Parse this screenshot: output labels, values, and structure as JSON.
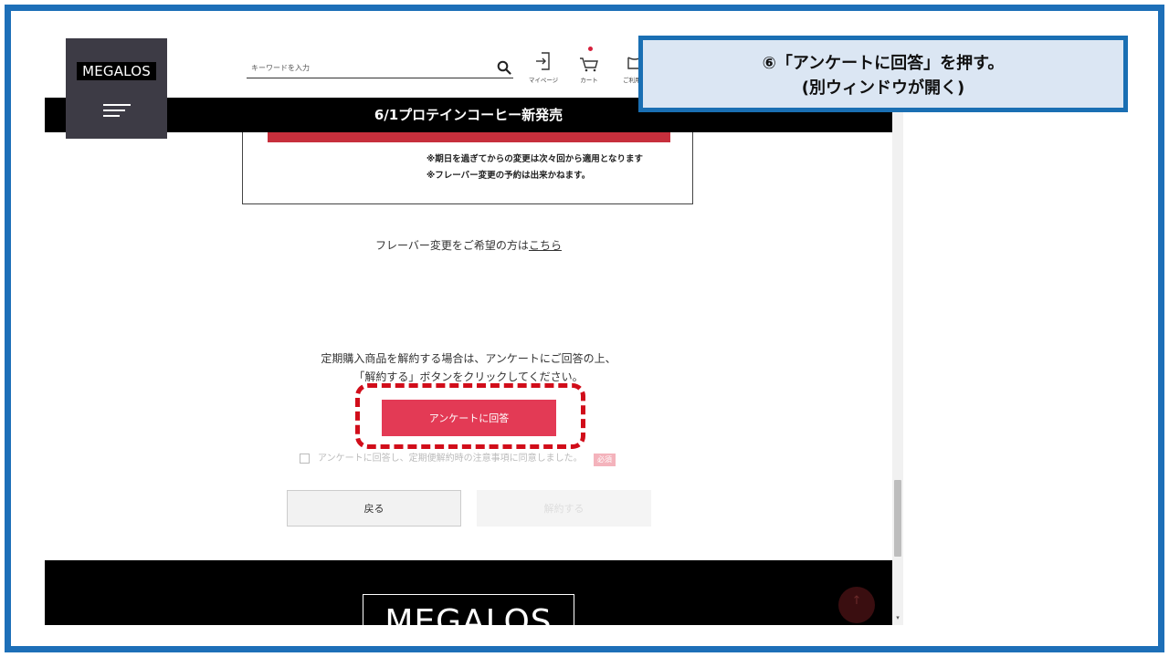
{
  "header": {
    "logo": "MEGALOS",
    "search_placeholder": "キーワードを入力",
    "mypage_label": "マイページ",
    "cart_label": "カート",
    "guide_label": "ご利用ガ"
  },
  "banner": {
    "text": "6/1プロテインコーヒー新発売"
  },
  "info_box": {
    "note1": "※期日を過ぎてからの変更は次々回から適用となります",
    "note2": "※フレーバー変更の予約は出来かねます。"
  },
  "flavor": {
    "text": "フレーバー変更をご希望の方は",
    "link": "こちら"
  },
  "cancel_note": {
    "line1": "定期購入商品を解約する場合は、アンケートにご回答の上、",
    "line2": "「解約する」ボタンをクリックしてください。"
  },
  "survey_button": "アンケートに回答",
  "consent": {
    "text": "アンケートに回答し、定期便解約時の注意事項に同意しました。",
    "badge": "必須"
  },
  "buttons": {
    "back": "戻る",
    "cancel": "解約する"
  },
  "footer": {
    "logo": "MEGALOS"
  },
  "callout": {
    "line1": "⑥「アンケートに回答」を押す。",
    "line2": "(別ウィンドウが開く)"
  },
  "colors": {
    "frame": "#1d6fb8",
    "accent_button": "#e33a55",
    "highlight_dashed": "#d10d1a",
    "callout_bg": "#dbe6f3"
  }
}
